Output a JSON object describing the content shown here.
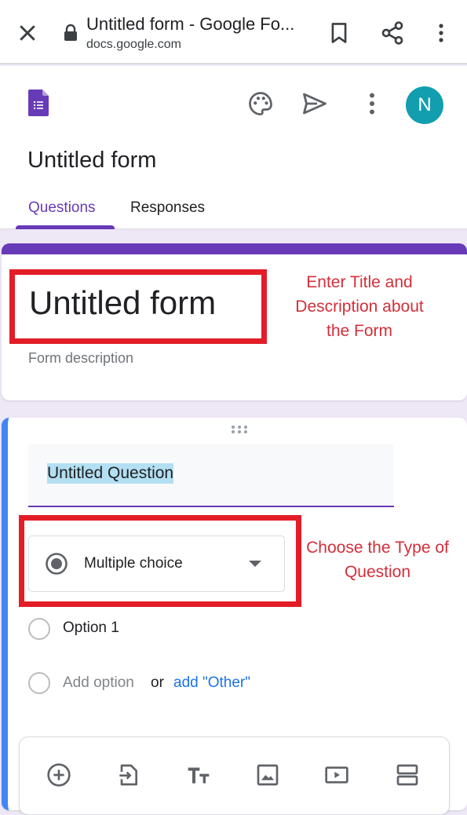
{
  "browser": {
    "page_title": "Untitled form - Google Fo...",
    "url": "docs.google.com",
    "icons": [
      "close-icon",
      "lock-icon",
      "bookmark-icon",
      "share-icon",
      "more-vert-icon"
    ]
  },
  "header": {
    "app_icon": "google-forms-logo",
    "actions": [
      "palette-icon",
      "send-icon",
      "more-vert-icon"
    ],
    "avatar_initial": "N",
    "avatar_color": "#129eaf",
    "form_title": "Untitled form",
    "tabs": [
      {
        "label": "Questions",
        "active": true
      },
      {
        "label": "Responses",
        "active": false
      }
    ]
  },
  "title_card": {
    "title": "Untitled form",
    "description_placeholder": "Form description",
    "accent_color": "#673ab7"
  },
  "annotations": {
    "title_note": "Enter Title and Description about the Form",
    "type_note": "Choose the Type of Question",
    "color": "#e21d27"
  },
  "question_card": {
    "question_text": "Untitled Question",
    "question_type": "Multiple choice",
    "options": [
      {
        "label": "Option 1"
      }
    ],
    "add_option_label": "Add option",
    "or_label": "or",
    "add_other_label": "add \"Other\"",
    "accent_color": "#4285f4"
  },
  "toolbar": {
    "items": [
      {
        "icon": "add-question-icon"
      },
      {
        "icon": "import-questions-icon"
      },
      {
        "icon": "add-title-icon"
      },
      {
        "icon": "add-image-icon"
      },
      {
        "icon": "add-video-icon"
      },
      {
        "icon": "add-section-icon"
      }
    ]
  }
}
